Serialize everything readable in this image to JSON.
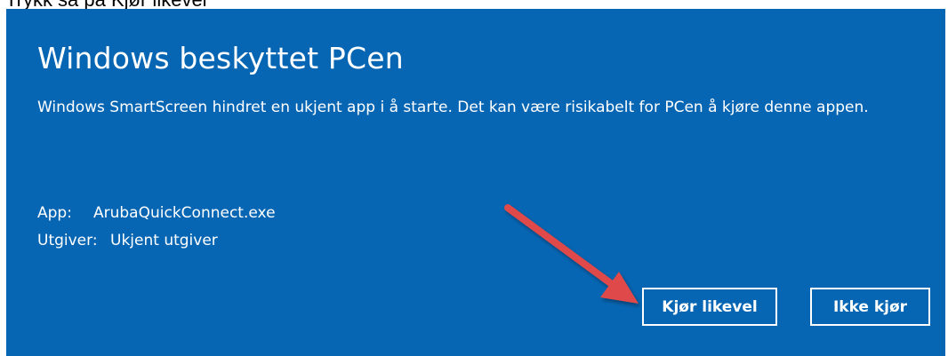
{
  "caption": "Trykk så på Kjør likevel",
  "dialog": {
    "title": "Windows beskyttet PCen",
    "message": "Windows SmartScreen hindret en ukjent app i å starte. Det kan være risikabelt for PCen å kjøre denne appen.",
    "app_label": "App:",
    "app_value": "ArubaQuickConnect.exe",
    "publisher_label": "Utgiver:",
    "publisher_value": "Ukjent utgiver",
    "run_anyway_label": "Kjør likevel",
    "dont_run_label": "Ikke kjør"
  },
  "colors": {
    "dialog_background": "#0766b3",
    "text": "#ffffff",
    "annotation_arrow": "#e04848"
  },
  "icons": {
    "annotation": "red-arrow-icon"
  }
}
